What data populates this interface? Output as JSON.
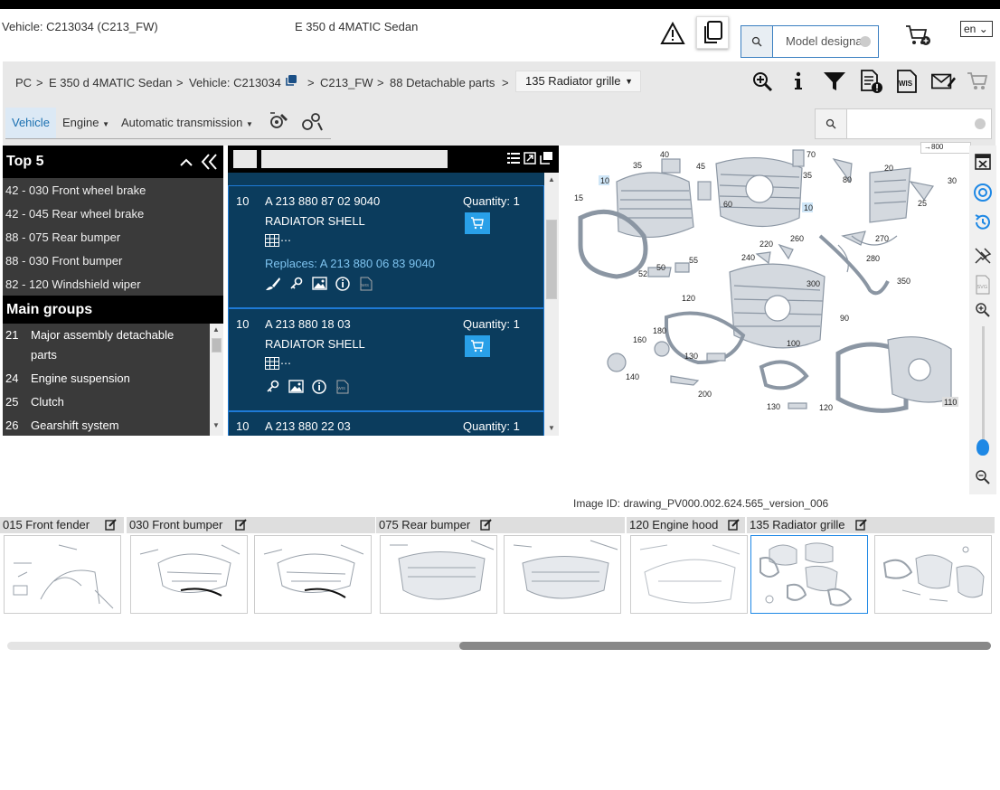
{
  "header": {
    "vehicle_id": "Vehicle: C213034 (C213_FW)",
    "model": "E 350 d 4MATIC Sedan",
    "model_search_placeholder": "Model designa",
    "language": "en"
  },
  "breadcrumb": {
    "items": [
      "PC",
      "E 350 d 4MATIC Sedan",
      "Vehicle: C213034",
      "C213_FW",
      "88 Detachable parts"
    ],
    "separator": ">",
    "selected": "135 Radiator grille"
  },
  "tabs": {
    "vehicle": "Vehicle",
    "engine": "Engine",
    "transmission": "Automatic transmission"
  },
  "left_panel": {
    "top5_title": "Top 5",
    "top5": [
      "42 - 030 Front wheel brake",
      "42 - 045 Rear wheel brake",
      "88 - 075 Rear bumper",
      "88 - 030 Front bumper",
      "82 - 120 Windshield wiper"
    ],
    "main_groups_title": "Main groups",
    "main_groups": [
      {
        "num": "21",
        "label": "Major assembly detachable",
        "label2": "parts"
      },
      {
        "num": "24",
        "label": "Engine suspension"
      },
      {
        "num": "25",
        "label": "Clutch"
      },
      {
        "num": "26",
        "label": "Gearshift system"
      }
    ]
  },
  "parts": [
    {
      "pos": "10",
      "number": "A 213 880 87 02 9040",
      "name": "RADIATOR SHELL",
      "qty": "Quantity: 1",
      "replaces": "Replaces: A 213 880 06 83 9040",
      "grid": "⋯"
    },
    {
      "pos": "10",
      "number": "A 213 880 18 03",
      "name": "RADIATOR SHELL",
      "qty": "Quantity: 1",
      "grid": "⋯"
    },
    {
      "pos": "10",
      "number": "A 213 880 22 03",
      "qty": "Quantity: 1"
    }
  ],
  "drawing": {
    "callouts": [
      "40",
      "45",
      "35",
      "70",
      "35",
      "80",
      "20",
      "30",
      "25",
      "15",
      "10",
      "60",
      "10",
      "220",
      "260",
      "270",
      "240",
      "280",
      "52",
      "50",
      "55",
      "300",
      "350",
      "120",
      "90",
      "160",
      "180",
      "100",
      "130",
      "140",
      "200",
      "130",
      "120",
      "110"
    ],
    "zoom_label": "800",
    "svc_label": "SVG"
  },
  "image_id": "Image ID: drawing_PV000.002.624.565_version_006",
  "thumbnails": {
    "labels": [
      "015 Front fender",
      "030 Front bumper",
      "075 Rear bumper",
      "120 Engine hood",
      "135 Radiator grille"
    ]
  },
  "colors": {
    "accent": "#1e88e5",
    "parts_bg": "#0b3c5d",
    "panel_dark": "#3a3a3a",
    "cart_blue": "#29a0e8"
  }
}
